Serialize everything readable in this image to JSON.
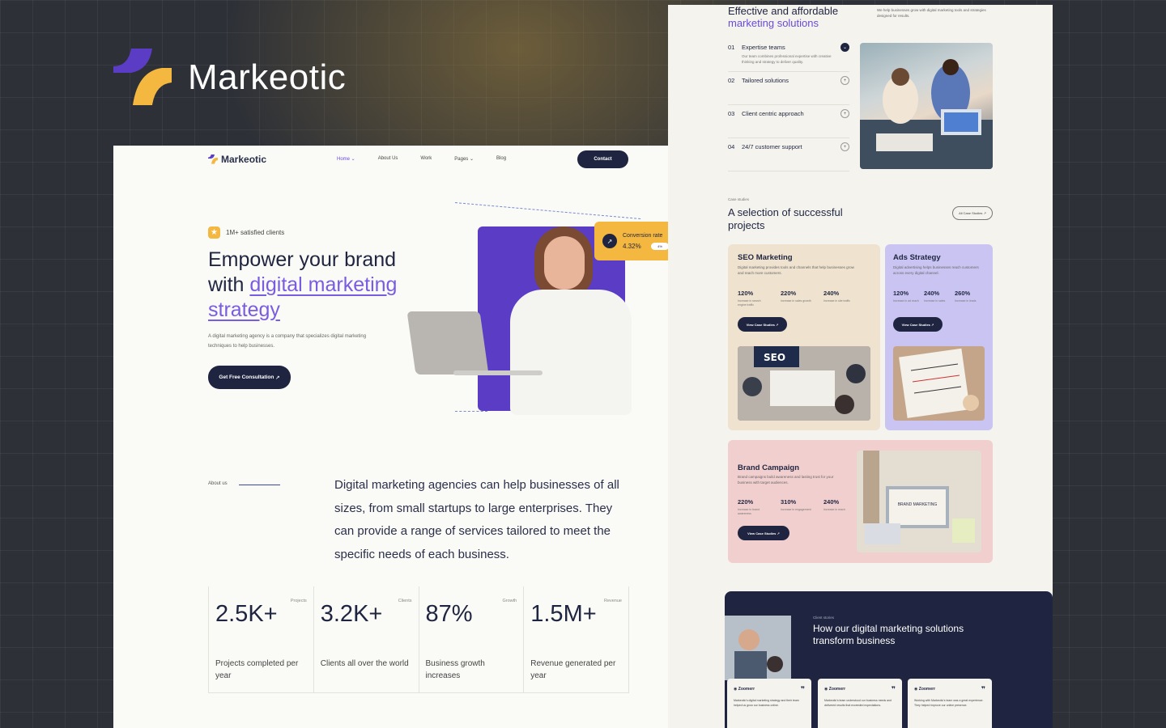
{
  "brand": {
    "name": "Markeotic",
    "logo_icon": "markeotic-logo-icon",
    "purple": "#5b3cc4",
    "yellow": "#f4b740"
  },
  "left": {
    "nav": {
      "logo": "Markeotic",
      "links": [
        "Home",
        "About Us",
        "Work",
        "Pages",
        "Blog"
      ],
      "contact": "Contact"
    },
    "hero": {
      "badge": "1M+ satisfied clients",
      "title_part1": "Empower your brand with ",
      "title_highlight": "digital marketing strategy",
      "description": "A digital marketing agency is a company that specializes digital marketing techniques to help businesses.",
      "cta": "Get Free Consultation",
      "conversion": {
        "label": "Conversion rate",
        "value": "4.32%",
        "pill": "4%"
      }
    },
    "about": {
      "label": "About us",
      "text": "Digital marketing agencies can help businesses of all sizes, from small startups to large enterprises. They can provide a range of services tailored to meet the specific needs of each business."
    },
    "stats": [
      {
        "tag": "Projects",
        "value": "2.5K+",
        "desc": "Projects completed per year"
      },
      {
        "tag": "Clients",
        "value": "3.2K+",
        "desc": "Clients all over the world"
      },
      {
        "tag": "Growth",
        "value": "87%",
        "desc": "Business growth increases"
      },
      {
        "tag": "Revenue",
        "value": "1.5M+",
        "desc": "Revenue generated per year"
      }
    ]
  },
  "right": {
    "section_title_1": "Effective and affordable",
    "section_title_2": "marketing solutions",
    "section_desc": "We help businesses grow with digital marketing tools and strategies designed for results.",
    "features": [
      {
        "num": "01",
        "label": "Expertise teams",
        "desc": "Our team combines professional expertise with creative thinking and strategy to deliver quality.",
        "icon": "arrow-down"
      },
      {
        "num": "02",
        "label": "Tailored solutions",
        "icon": "plus"
      },
      {
        "num": "03",
        "label": "Client centric approach",
        "icon": "plus"
      },
      {
        "num": "04",
        "label": "24/7 customer support",
        "icon": "plus"
      }
    ],
    "projects_sub": "Case studies",
    "projects_title": "A selection of successful projects",
    "projects_btn": "All Case Studies",
    "cards": [
      {
        "title": "SEO Marketing",
        "desc": "Digital marketing provides tools and channels that help businesses grow and reach more customers.",
        "stats": [
          {
            "value": "120%",
            "label": "Increase in search engine traffic"
          },
          {
            "value": "220%",
            "label": "Increase in sales growth"
          },
          {
            "value": "240%",
            "label": "Increase in site traffic"
          }
        ],
        "btn": "View Case Studies",
        "bg": "#efe3cf"
      },
      {
        "title": "Ads Strategy",
        "desc": "Digital advertising helps businesses reach customers across every digital channel.",
        "stats": [
          {
            "value": "120%",
            "label": "Increase in ad reach"
          },
          {
            "value": "240%",
            "label": "Increase in sales"
          },
          {
            "value": "260%",
            "label": "Increase in leads"
          }
        ],
        "btn": "View Case Studies",
        "bg": "#c9c4f2"
      },
      {
        "title": "Brand Campaign",
        "desc": "Brand campaigns build awareness and lasting trust for your business with target audiences.",
        "stats": [
          {
            "value": "220%",
            "label": "Increase in brand awareness"
          },
          {
            "value": "310%",
            "label": "Increase in engagement"
          },
          {
            "value": "240%",
            "label": "Increase in reach"
          }
        ],
        "btn": "View Case Studies",
        "bg": "#f2cfcf",
        "image_text": "BRAND MARKETING"
      }
    ],
    "testimonials": {
      "sub": "Client stories",
      "title": "How our digital marketing solutions transform business",
      "cards": [
        {
          "brand": "Zoomerr",
          "text": "Markeotic's digital marketing strategy and their team helped us grow our business online."
        },
        {
          "brand": "Zoomerr",
          "text": "Markeotic's team understood our business needs and delivered results that exceeded expectations."
        },
        {
          "brand": "Zoomerr",
          "text": "Working with Markeotic's team was a great experience. They helped improve our online presence."
        }
      ]
    }
  }
}
